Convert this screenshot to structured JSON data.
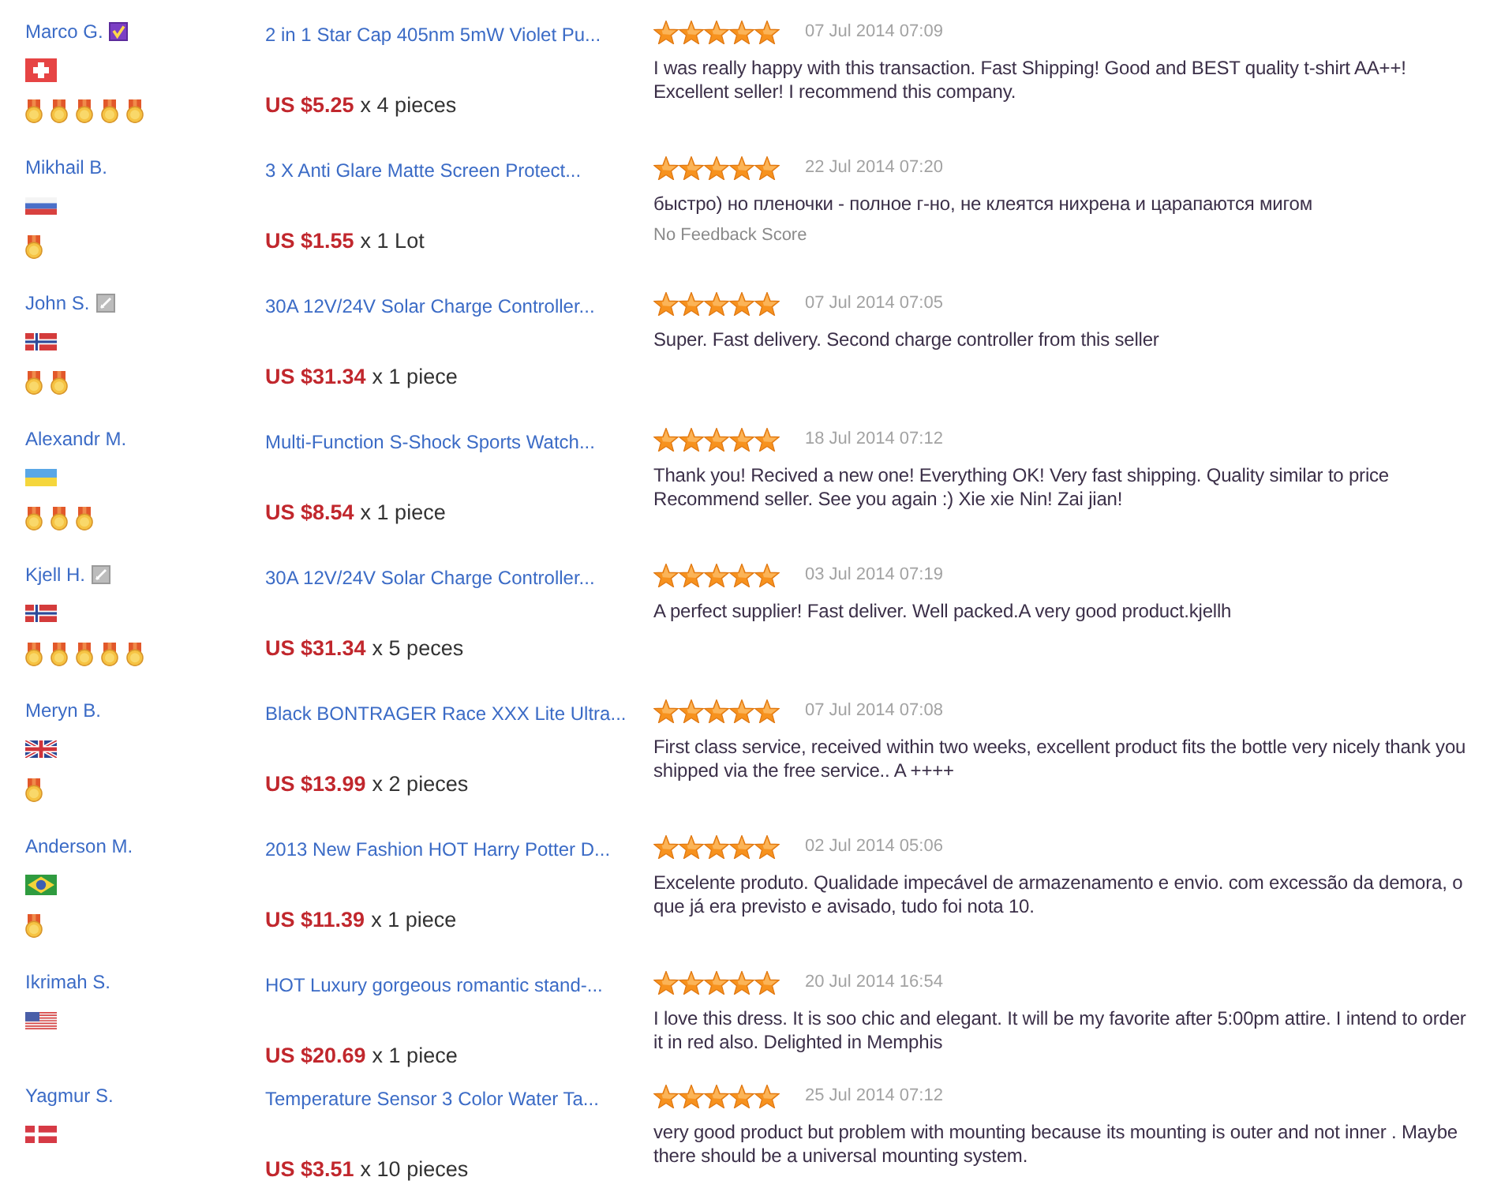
{
  "feedback": [
    {
      "buyer": {
        "name": "Marco G.",
        "badge": {
          "active": true
        },
        "flag": {
          "kind": "switzerland"
        },
        "medals": [
          {
            "kind": "medal"
          },
          {
            "kind": "medal"
          },
          {
            "kind": "medal"
          },
          {
            "kind": "medal"
          },
          {
            "kind": "medal"
          }
        ]
      },
      "product": {
        "title": "2 in 1 Star Cap 405nm 5mW Violet Pu...",
        "price": "US $5.25",
        "quantity": "x 4 pieces"
      },
      "review": {
        "stars": 5,
        "date": "07 Jul 2014 07:09",
        "text": "I was really happy with this transaction. Fast Shipping! Good and BEST quality t-shirt AA++! Excellent seller! I recommend this company."
      }
    },
    {
      "buyer": {
        "name": "Mikhail B.",
        "flag": {
          "kind": "russia"
        },
        "medals": [
          {
            "kind": "medal"
          }
        ]
      },
      "product": {
        "title": "3 X Anti Glare Matte Screen Protect...",
        "price": "US $1.55",
        "quantity": "x 1 Lot"
      },
      "review": {
        "stars": 5,
        "date": "22 Jul 2014 07:20",
        "text": "быстро) но пленочки - полное г-но, не клеятся нихрена и царапаются мигом",
        "note": "No Feedback Score"
      }
    },
    {
      "buyer": {
        "name": "John S.",
        "badge": {
          "active": false
        },
        "flag": {
          "kind": "norway"
        },
        "medals": [
          {
            "kind": "medal"
          },
          {
            "kind": "medal"
          }
        ]
      },
      "product": {
        "title": "30A 12V/24V Solar Charge Controller...",
        "price": "US $31.34",
        "quantity": "x 1 piece"
      },
      "review": {
        "stars": 5,
        "date": "07 Jul 2014 07:05",
        "text": "Super. Fast delivery. Second charge controller from this seller"
      }
    },
    {
      "buyer": {
        "name": "Alexandr M.",
        "flag": {
          "kind": "ukraine"
        },
        "medals": [
          {
            "kind": "medal"
          },
          {
            "kind": "medal"
          },
          {
            "kind": "medal"
          }
        ]
      },
      "product": {
        "title": "Multi-Function S-Shock Sports Watch...",
        "price": "US $8.54",
        "quantity": "x 1 piece"
      },
      "review": {
        "stars": 5,
        "date": "18 Jul 2014 07:12",
        "text": "Thank you! Recived a new one! Everything OK! Very fast shipping. Quality similar to price Recommend seller. See you again :) Xie xie Nin! Zai jian!"
      }
    },
    {
      "buyer": {
        "name": "Kjell H.",
        "badge": {
          "active": false
        },
        "flag": {
          "kind": "norway"
        },
        "medals": [
          {
            "kind": "medal"
          },
          {
            "kind": "medal"
          },
          {
            "kind": "medal"
          },
          {
            "kind": "medal"
          },
          {
            "kind": "medal"
          }
        ]
      },
      "product": {
        "title": "30A 12V/24V Solar Charge Controller...",
        "price": "US $31.34",
        "quantity": "x 5 peces"
      },
      "review": {
        "stars": 5,
        "date": "03 Jul 2014 07:19",
        "text": "A perfect supplier! Fast deliver. Well packed.A very good product.kjellh"
      }
    },
    {
      "buyer": {
        "name": "Meryn B.",
        "flag": {
          "kind": "uk"
        },
        "medals": [
          {
            "kind": "medal"
          }
        ]
      },
      "product": {
        "title": "Black BONTRAGER Race XXX Lite Ultra...",
        "price": "US $13.99",
        "quantity": "x 2 pieces"
      },
      "review": {
        "stars": 5,
        "date": "07 Jul 2014 07:08",
        "text": "First class service, received within two weeks, excellent product fits the bottle very nicely thank you shipped via the free service.. A ++++"
      }
    },
    {
      "buyer": {
        "name": "Anderson M.",
        "flag": {
          "kind": "brazil"
        },
        "medals": [
          {
            "kind": "medal"
          }
        ]
      },
      "product": {
        "title": "2013 New Fashion HOT Harry Potter D...",
        "price": "US $11.39",
        "quantity": "x 1 piece"
      },
      "review": {
        "stars": 5,
        "date": "02 Jul 2014 05:06",
        "text": "Excelente produto. Qualidade impecável de armazenamento e envio. com excessão da demora, o que já era previsto e avisado, tudo foi nota 10."
      }
    },
    {
      "buyer": {
        "name": "Ikrimah S.",
        "flag": {
          "kind": "usa"
        }
      },
      "product": {
        "title": "HOT Luxury gorgeous romantic stand-...",
        "price": "US $20.69",
        "quantity": "x 1 piece"
      },
      "review": {
        "stars": 5,
        "date": "20 Jul 2014 16:54",
        "text": "I love this dress. It is soo chic and elegant. It will be my favorite after 5:00pm attire. I intend to order it in red also. Delighted in Memphis"
      }
    },
    {
      "buyer": {
        "name": "Yagmur S.",
        "flag": {
          "kind": "denmark"
        }
      },
      "product": {
        "title": "Temperature Sensor 3 Color Water Ta...",
        "price": "US $3.51",
        "quantity": "x 10 pieces"
      },
      "review": {
        "stars": 5,
        "date": "25 Jul 2014 07:12",
        "text": "very good product but problem with mounting because its mounting is outer and not inner . Maybe there should be a universal mounting system."
      }
    }
  ]
}
